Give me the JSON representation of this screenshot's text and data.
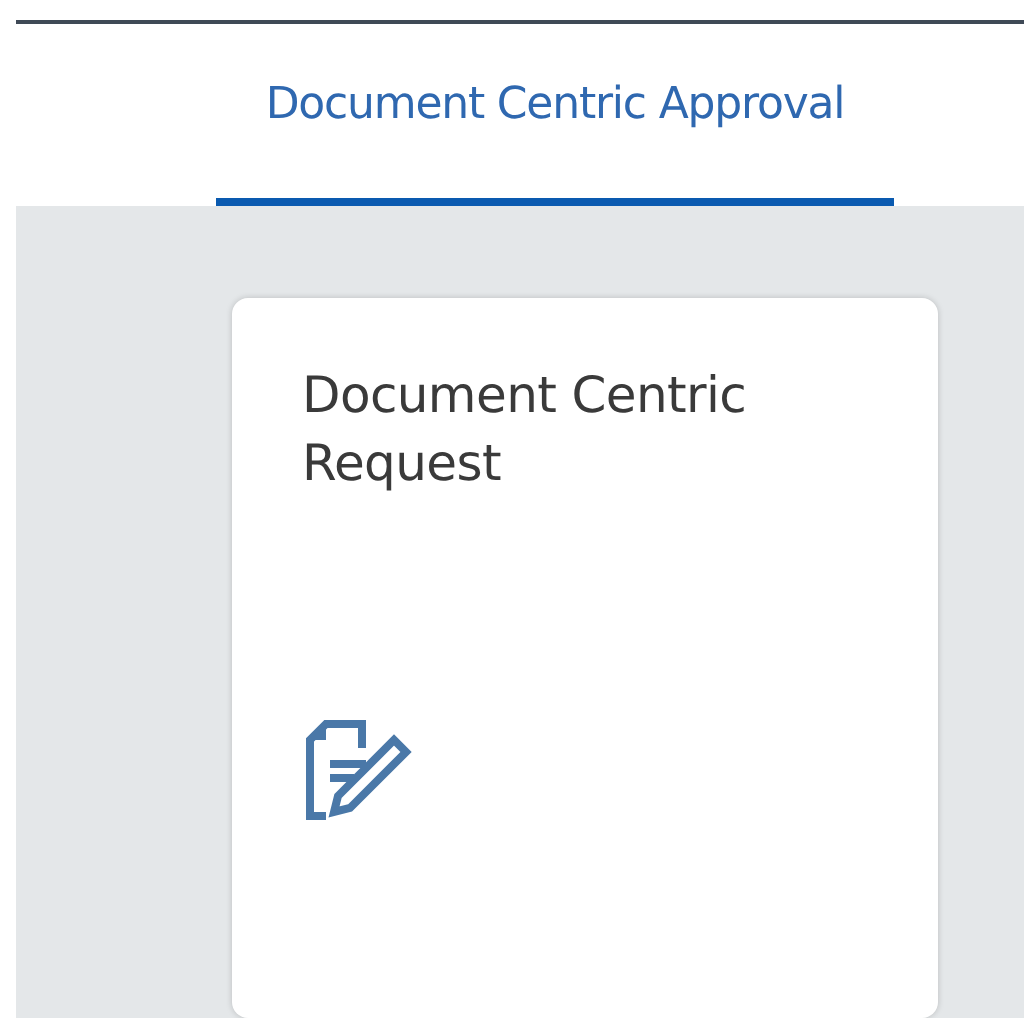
{
  "tabs": [
    {
      "label": "Document Centric Approval",
      "selected": true
    }
  ],
  "tiles": [
    {
      "title": "Document Centric Request",
      "kind": "document-edit"
    }
  ]
}
